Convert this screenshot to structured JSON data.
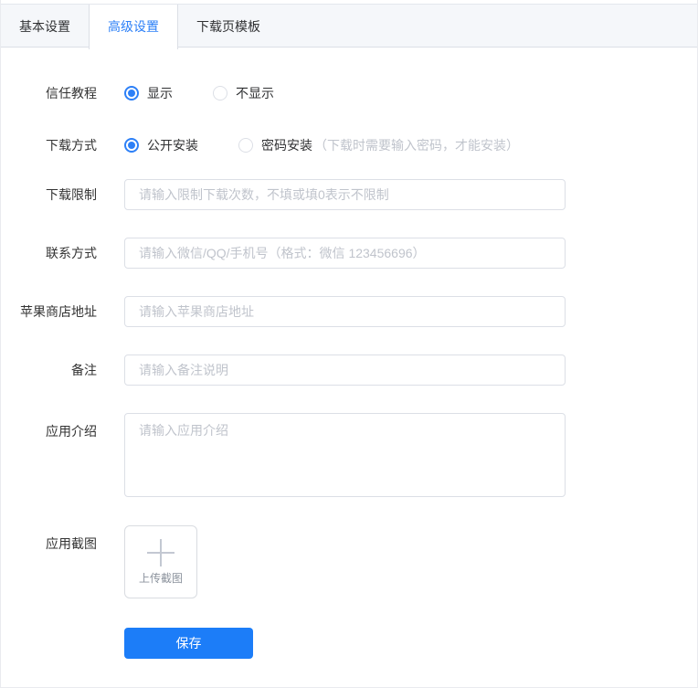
{
  "tabs": [
    {
      "label": "基本设置",
      "active": false
    },
    {
      "label": "高级设置",
      "active": true
    },
    {
      "label": "下载页模板",
      "active": false
    }
  ],
  "form": {
    "trust_tutorial": {
      "label": "信任教程",
      "options": [
        {
          "label": "显示",
          "selected": true
        },
        {
          "label": "不显示",
          "selected": false
        }
      ]
    },
    "download_method": {
      "label": "下载方式",
      "options": [
        {
          "label": "公开安装",
          "selected": true
        },
        {
          "label": "密码安装",
          "selected": false,
          "note": "（下载时需要输入密码，才能安装）"
        }
      ]
    },
    "download_limit": {
      "label": "下载限制",
      "value": "",
      "placeholder": "请输入限制下载次数，不填或填0表示不限制"
    },
    "contact": {
      "label": "联系方式",
      "value": "",
      "placeholder": "请输入微信/QQ/手机号（格式：微信 123456696）"
    },
    "apple_store_url": {
      "label": "苹果商店地址",
      "value": "",
      "placeholder": "请输入苹果商店地址"
    },
    "remark": {
      "label": "备注",
      "value": "",
      "placeholder": "请输入备注说明"
    },
    "app_intro": {
      "label": "应用介绍",
      "value": "",
      "placeholder": "请输入应用介绍"
    },
    "app_screenshot": {
      "label": "应用截图",
      "upload_text": "上传截图",
      "icon": "plus-icon"
    }
  },
  "actions": {
    "save_label": "保存"
  },
  "colors": {
    "accent": "#2d80f7",
    "save_button_bg": "#1c7df8",
    "tab_header_bg": "#f5f7fa",
    "border": "#dcdfe6",
    "placeholder_text": "#c0c4cc"
  }
}
